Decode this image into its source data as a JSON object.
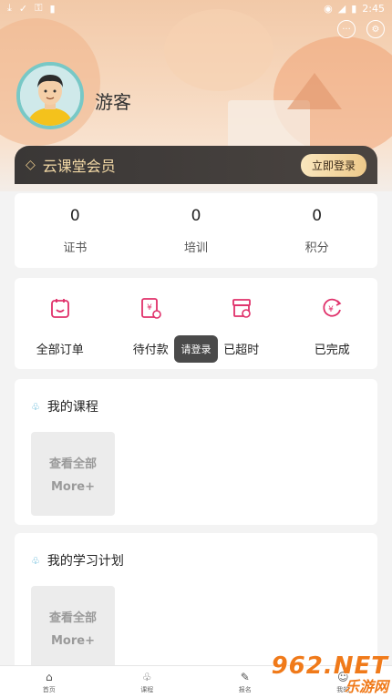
{
  "status_bar": {
    "time": "2:45",
    "left_icons": [
      "download-icon",
      "check-icon",
      "key-icon",
      "sim-icon"
    ],
    "right_icons": [
      "wifi-icon",
      "signal-icon",
      "battery-icon"
    ]
  },
  "header": {
    "username": "游客",
    "icons": [
      "message-icon",
      "settings-icon"
    ]
  },
  "member": {
    "title": "云课堂会员",
    "login_label": "立即登录"
  },
  "stats": [
    {
      "value": "0",
      "label": "证书"
    },
    {
      "value": "0",
      "label": "培训"
    },
    {
      "value": "0",
      "label": "积分"
    }
  ],
  "orders": [
    {
      "label": "全部订单",
      "icon": "order-list-icon"
    },
    {
      "label": "待付款",
      "icon": "pending-payment-icon"
    },
    {
      "label": "已超时",
      "icon": "timeout-icon"
    },
    {
      "label": "已完成",
      "icon": "completed-icon"
    }
  ],
  "toast": "请登录",
  "my_courses": {
    "title": "我的课程",
    "more_line1": "查看全部",
    "more_line2": "More+"
  },
  "my_plan": {
    "title": "我的学习计划",
    "more_line1": "查看全部",
    "more_line2": "More+"
  },
  "bottom_nav": [
    {
      "label": "首页",
      "icon": "home-icon"
    },
    {
      "label": "课程",
      "icon": "course-icon"
    },
    {
      "label": "报名",
      "icon": "signup-icon"
    },
    {
      "label": "我的",
      "icon": "profile-icon"
    }
  ],
  "watermark": {
    "line1": "962.NET",
    "line2": "乐游网"
  },
  "colors": {
    "accent": "#e0306a",
    "member_bg": "#3a3736",
    "member_text": "#f3d9a6",
    "avatar_ring": "#78c8c6"
  }
}
